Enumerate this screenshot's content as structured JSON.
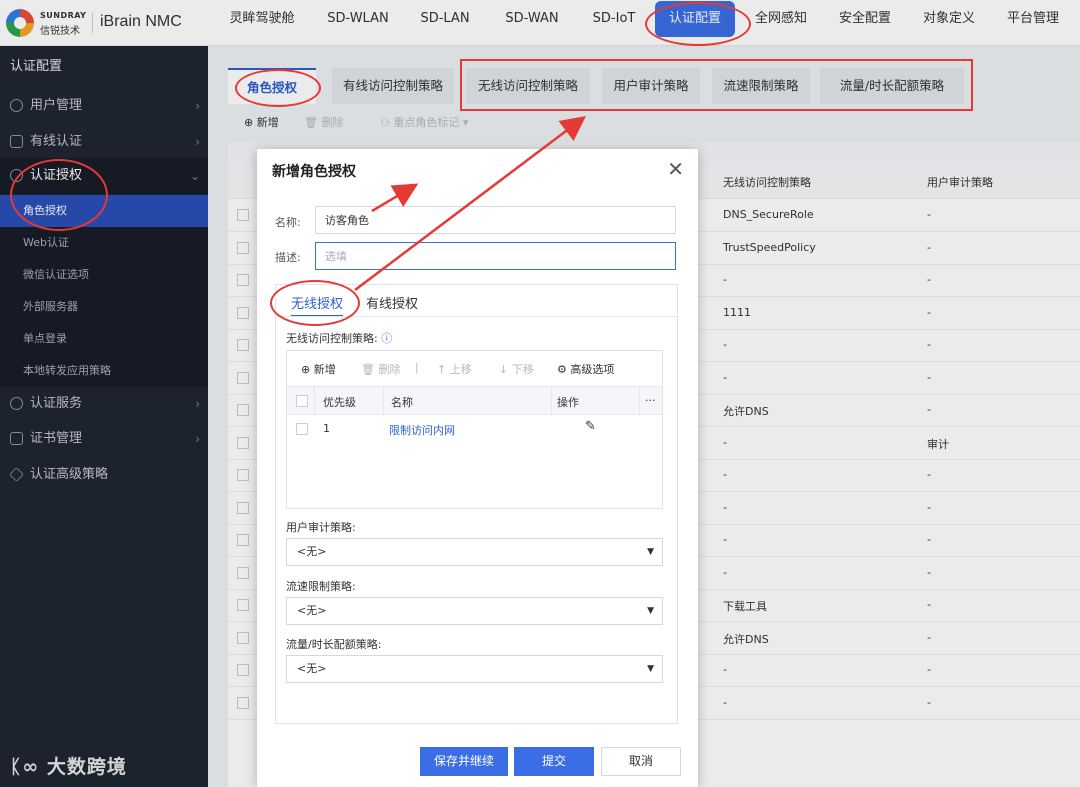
{
  "brand": {
    "en": "SUNDRAY",
    "cn": "信锐技术",
    "product": "iBrain NMC"
  },
  "topnav": [
    "灵眸驾驶舱",
    "SD-WLAN",
    "SD-LAN",
    "SD-WAN",
    "SD-IoT",
    "认证配置",
    "全网感知",
    "安全配置",
    "对象定义",
    "平台管理"
  ],
  "sidebar": {
    "title": "认证配置",
    "groups": [
      "用户管理",
      "有线认证",
      "认证授权",
      "认证服务",
      "证书管理",
      "认证高级策略"
    ],
    "subitems": [
      "角色授权",
      "Web认证",
      "微信认证选项",
      "外部服务器",
      "单点登录",
      "本地转发应用策略"
    ]
  },
  "watermark": "大数跨境",
  "content_tabs": [
    "角色授权",
    "有线访问控制策略",
    "无线访问控制策略",
    "用户审计策略",
    "流速限制策略",
    "流量/时长配额策略"
  ],
  "toolbar": {
    "add": "新增",
    "delete": "删除",
    "tag": "重点角色标记 ▾"
  },
  "bg_table": {
    "headers": [
      "无线访问控制策略",
      "用户审计策略"
    ],
    "rows": [
      [
        "DNS_SecureRole",
        "-"
      ],
      [
        "TrustSpeedPolicy",
        "-"
      ],
      [
        "-",
        "-"
      ],
      [
        "1111",
        "-"
      ],
      [
        "-",
        "-"
      ],
      [
        "-",
        "-"
      ],
      [
        "允许DNS",
        "-"
      ],
      [
        "-",
        "审计"
      ],
      [
        "-",
        "-"
      ],
      [
        "-",
        "-"
      ],
      [
        "-",
        "-"
      ],
      [
        "-",
        "-"
      ],
      [
        "下载工具",
        "-"
      ],
      [
        "允许DNS",
        "-"
      ],
      [
        "-",
        "-"
      ],
      [
        "-",
        "-"
      ]
    ]
  },
  "modal": {
    "title": "新增角色授权",
    "name_label": "名称:",
    "name_value": "访客角色",
    "desc_label": "描述:",
    "desc_placeholder": "选填",
    "tabs": [
      "无线授权",
      "有线授权"
    ],
    "wireless_policy_label": "无线访问控制策略:",
    "inner_toolbar": {
      "add": "新增",
      "delete": "删除",
      "up": "上移",
      "down": "下移",
      "advanced": "高级选项"
    },
    "inner_headers": {
      "priority": "优先级",
      "name": "名称",
      "op": "操作",
      "more": "···"
    },
    "inner_row": {
      "priority": "1",
      "name": "限制访问内网"
    },
    "audit_label": "用户审计策略:",
    "audit_value": "<无>",
    "speed_label": "流速限制策略:",
    "speed_value": "<无>",
    "quota_label": "流量/时长配额策略:",
    "quota_value": "<无>",
    "buttons": {
      "save_continue": "保存并继续",
      "submit": "提交",
      "cancel": "取消"
    }
  },
  "colors": {
    "accent": "#3b6ee6",
    "annotation": "#e53935",
    "sidebar": "#1f2633"
  }
}
